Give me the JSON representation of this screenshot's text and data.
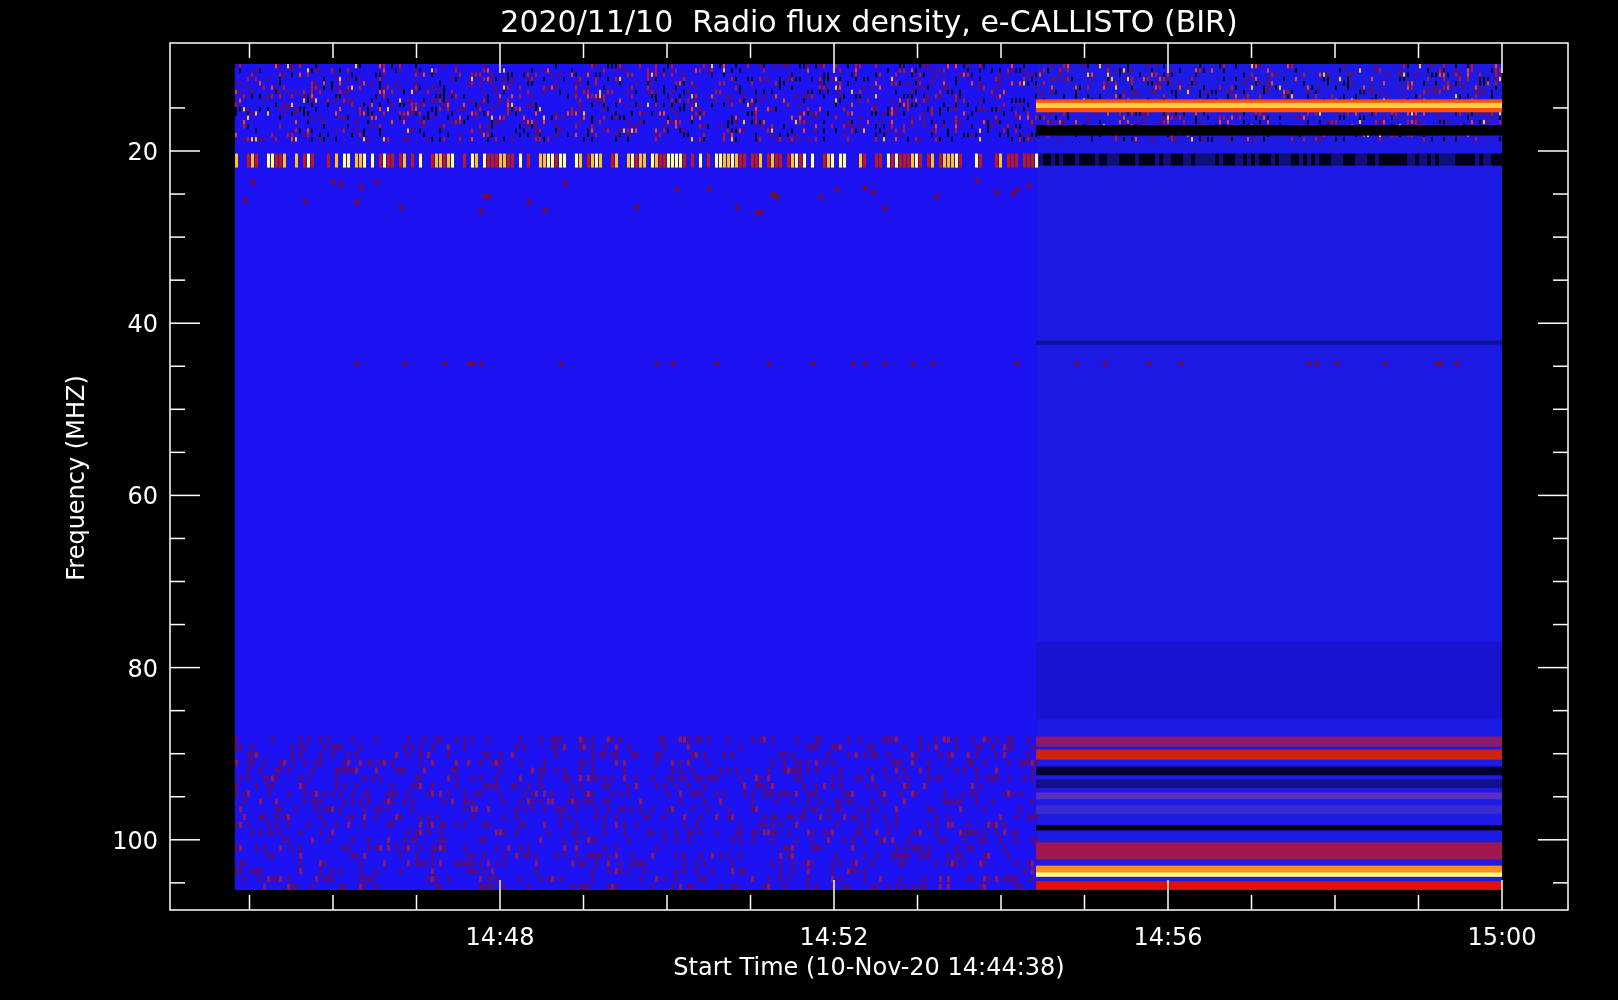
{
  "title": "2020/11/10  Radio flux density, e-CALLISTO (BIR)",
  "y_axis": {
    "label": "Frequency (MHZ)",
    "tick_labels": [
      "20",
      "40",
      "60",
      "80",
      "100"
    ]
  },
  "x_axis": {
    "label": "Start Time (10-Nov-20 14:44:38)",
    "tick_labels": [
      "14:48",
      "14:52",
      "14:56",
      "15:00"
    ]
  }
}
